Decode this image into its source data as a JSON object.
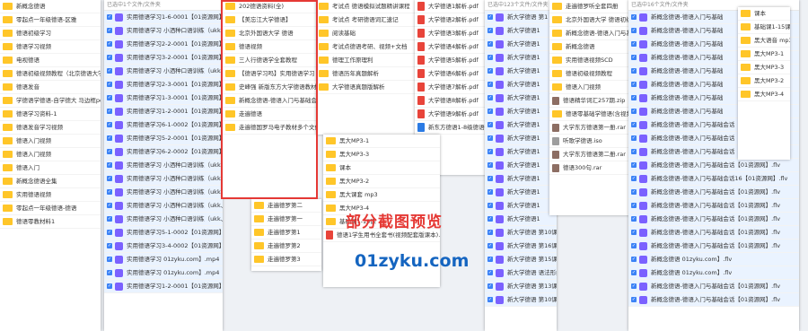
{
  "panel_a": {
    "rows": [
      "新概念德语",
      "零起点一年级德语-区雅",
      "德语初级学习",
      "德语学习视频",
      "电视德语",
      "德语初级视频教程（北京德语大学-刘-写作）",
      "德语发音",
      "学德语学德语-自学德大 马边框pdf+音频",
      "德语学习资料-1",
      "德语发音学习视频",
      "德语入门视频",
      "德语入门视频",
      "德语入门",
      "新概念德语全集",
      "实用德语视频",
      "零起点一年级德语-德语",
      "德语零教材料1"
    ]
  },
  "panel_b": {
    "header": "已选中1个文件/文件夹",
    "rows": [
      "实用德语学习1-6-0001【01资源网】",
      "实用德语学习 小洒种口语训练（ukk、",
      "实用德语学习2-2-0001【01资源网】",
      "实用德语学习3-2-0001【01资源网】",
      "实用德语学习 小洒种口语训练（ukk、4",
      "实用德语学习2-3-0001【01资源网】",
      "实用德语学习1-3-0001【01资源网】",
      "实用德语学习1-2-0001【01资源网】",
      "实用德语学习6-1-0002【01资源网】",
      "实用德语学习5-2-0001【01资源网】",
      "实用德语学习6-2-0002【01资源网】",
      "实用德语学习 小洒种口语训练（ukk、5-",
      "实用德语学习 小洒种口语训练（ukk、5-",
      "实用德语学习 小洒种口语训练（ukk、5-",
      "实用德语学习 小洒种口语训练（ukk、4-",
      "实用德语学习 小洒种口语训练（ukk、4-1-0001【01资源网】",
      "实用德语学习5-1-0002【01资源网】",
      "实用德语学习3-4-0002【01资源网】",
      "实用德语学习 01zyku.com】.mp4",
      "实用德语学习 01zyku.com】.mp4",
      "实用德语学习1-2-0001【01资源网】.mp4"
    ]
  },
  "panel_c": {
    "rows": [
      "202德语资料(全)",
      "【美忘江大学德语】",
      "北京外国语大学 德语",
      "德语视频",
      "三人行德语学全套教程",
      "【德语学习吗】实用德语学习",
      "史峰强 新版东方大学德语教材1-4",
      "新概念德语-德语入门与基础会话",
      "走遍德语",
      "走遍德国罗马电子教材多个文件"
    ]
  },
  "panel_d": {
    "rows": [
      "考试点 德语模拟试题精讲课程",
      "考试点 考研德语词汇速记",
      "阅读基础",
      "考试点德语考研、视频+文档",
      "德理工作原理利",
      "德语历年真题解析",
      "大学德语真题版解析"
    ]
  },
  "panel_e": {
    "rows": [
      "大学德语1解析.pdf",
      "大学德语2解析.pdf",
      "大学德语3解析.pdf",
      "大学德语4解析.pdf",
      "大学德语5解析.pdf",
      "大学德语6解析.pdf",
      "大学德语7解析.pdf",
      "大学德语8解析.pdf",
      "大学德语9解析.pdf",
      "新东方德语1-8级德语德语"
    ]
  },
  "panel_f": {
    "rows": [
      "黑大MP3-1",
      "黑大MP3-3",
      "课本",
      "黑大MP3-2",
      "黑大课套 mp3",
      "黑大MP3-4",
      "基础课1-15课",
      "德语1学生用书全套书(视频配套版课本).pdf"
    ]
  },
  "panel_g": {
    "rows": [
      "走遍德罗第二",
      "走遍德罗第一",
      "走遍德罗第1",
      "走遍德罗第2",
      "走遍德罗第3"
    ]
  },
  "panel_h": {
    "header": "已选中123个文件/文件夹",
    "rows": [
      "新大学德语 第1",
      "新大学德语1",
      "新大学德语1",
      "新大学德语1",
      "新大学德语1",
      "新大学德语1",
      "新大学德语1",
      "新大学德语1",
      "新大学德语1",
      "新大学德语1",
      "新大学德语1",
      "新大学德语1",
      "新大学德语1",
      "新大学德语1",
      "新大学德语1",
      "新大学德语1",
      "新大学德语 第10课 2022年 生词.flv",
      "新大学德语 第16课 德语语言学行-1000字写作系统.flv",
      "新大学德语 第15课 课 文.flv",
      "新大学德语 语法形编词，物主代、词性动词.flv",
      "新大学德语 第13课 语法短语的和代 分析.flv",
      "新大学德语 第10课 语法短语的取交信化词德.flv"
    ]
  },
  "panel_i": {
    "rows": [
      "走遍德罗听全套四册",
      "北京外国语大学 德语初级 1",
      "新概念德语-德语入门与基础",
      "新概念德语",
      "实用德语视频SCD",
      "德语初级视频教程",
      "德语入门视频",
      "德语精华词汇257期.zip",
      "德语零基础学德语(含视频+...",
      "大学东方德语第一册.rar",
      "听歌学德语.iso",
      "大学东方德语第二册.rar",
      "德语300句.rar"
    ]
  },
  "panel_j": {
    "header": "已选中16个文件/文件夹",
    "rows": [
      "新概念德语-德语入门与基础",
      "新概念德语-德语入门与基础",
      "新概念德语-德语入门与基础",
      "新概念德语-德语入门与基础",
      "新概念德语-德语入门与基础",
      "新概念德语-德语入门与基础",
      "新概念德语-德语入门与基础",
      "新概念德语-德语入门与基础",
      "新概念德语-德语入门与基础会话【01资源网】.flv",
      "新概念德语-德语入门与基础会话【01资源网】.flv",
      "新概念德语-德语入门与基础会话【01资源网】.flv",
      "新概念德语-德语入门与基础会话【01资源网】.flv",
      "新概念德语-德语入门与基础会话16【01资源网】.flv",
      "新概念德语-德语入门与基础会话【01资源网】.flv",
      "新概念德语-德语入门与基础会话【01资源网】.flv",
      "新概念德语-德语入门与基础会话【01资源网】.flv",
      "新概念德语-德语入门与基础会话【01资源网】.flv",
      "新概念德语-德语入门与基础会话【01资源网】.flv",
      "新概念德语 01zyku.com】.flv",
      "新概念德语 01zyku.com】.flv",
      "新概念德语-德语入门与基础会话【01资源网】.flv",
      "新概念德语-德语入门与基础会话【01资源网】.flv"
    ]
  },
  "panel_k": {
    "rows": [
      "课本",
      "基础课1-15课",
      "黑大语音 mp3",
      "黑大MP3-1",
      "黑大MP3-3",
      "黑大MP3-2",
      "黑大MP3-4"
    ]
  },
  "overlay": {
    "promo": "部分截图预览",
    "site": "01zyku.com"
  },
  "colors": {
    "frame": "#e53935",
    "promo": "#e53935",
    "site": "#1565c0",
    "folder": "#ffc629",
    "video": "#7b61ff",
    "pdf": "#e8443a",
    "select": "#3b82f6"
  }
}
